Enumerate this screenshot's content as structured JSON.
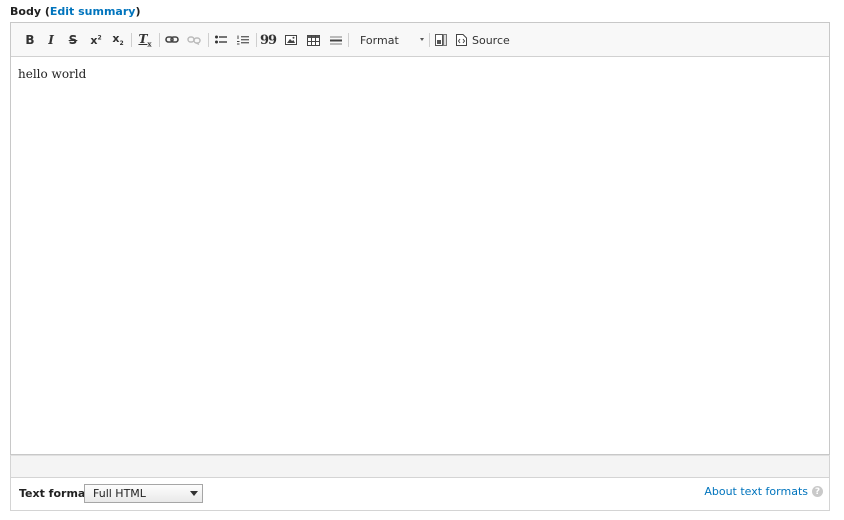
{
  "field": {
    "label": "Body",
    "open_paren": "(",
    "edit_summary": "Edit summary",
    "close_paren": ")"
  },
  "toolbar": {
    "bold": "B",
    "italic": "I",
    "strike": "S",
    "superscript": "x",
    "superscript_mark": "2",
    "subscript": "x",
    "subscript_mark": "2",
    "remove_format": "T",
    "remove_format_mark": "x",
    "quote": "99",
    "format_label": "Format",
    "source_label": "Source",
    "icons": [
      "bold",
      "italic",
      "strikethrough",
      "superscript",
      "subscript",
      "remove-format",
      "link",
      "unlink",
      "bulleted-list",
      "numbered-list",
      "blockquote",
      "image",
      "table",
      "horizontal-rule",
      "format-dropdown",
      "maximize",
      "source"
    ]
  },
  "editor": {
    "content": "hello world"
  },
  "text_format": {
    "label": "Text format",
    "selected": "Full HTML",
    "about_link": "About text formats",
    "help": "?"
  },
  "colors": {
    "link": "#0074bd",
    "toolbar_bg": "#f8f8f8",
    "border": "#c8c8c8"
  }
}
